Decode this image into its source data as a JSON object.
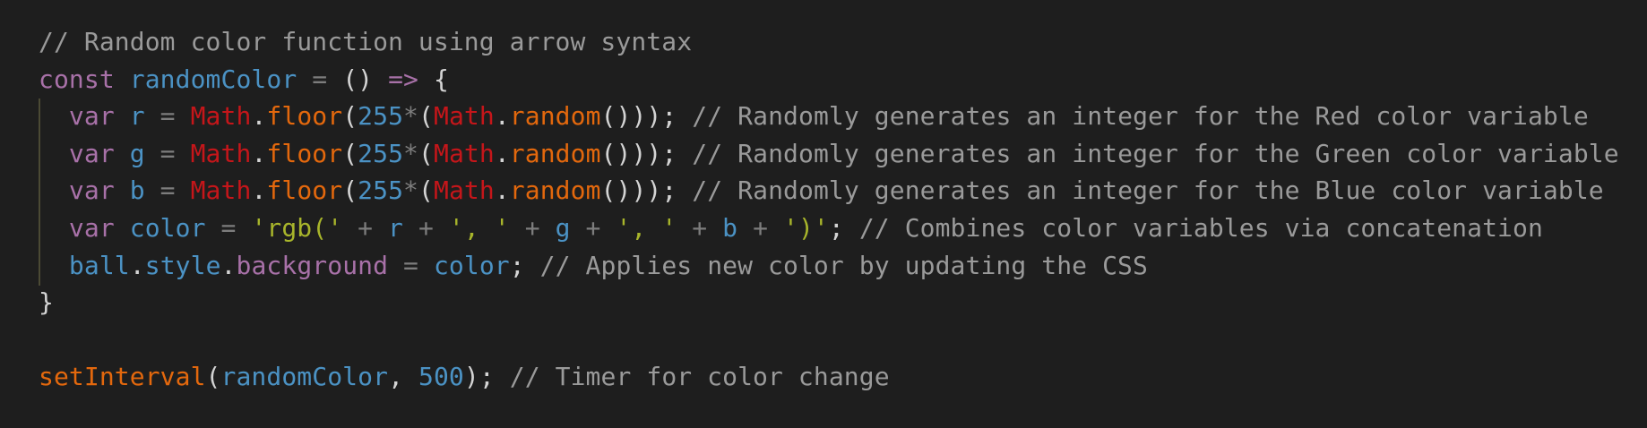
{
  "colors": {
    "background": "#1e1e1e",
    "comment": "#9a9a9a",
    "keyword": "#a871a8",
    "identifier": "#4b92c4",
    "builtin_object": "#c5161a",
    "function": "#e3680d",
    "string": "#a8b52b"
  },
  "code_lines": [
    [
      [
        "cm",
        "// Random color function using arrow syntax"
      ]
    ],
    [
      [
        "kw",
        "const"
      ],
      [
        "pn",
        " "
      ],
      [
        "id",
        "randomColor"
      ],
      [
        "op",
        " = "
      ],
      [
        "pn",
        "() "
      ],
      [
        "kw",
        "=>"
      ],
      [
        "pn",
        " {"
      ]
    ],
    [
      [
        "pn",
        "  "
      ],
      [
        "kw",
        "var"
      ],
      [
        "id",
        " r"
      ],
      [
        "op",
        " = "
      ],
      [
        "obj",
        "Math"
      ],
      [
        "pn",
        "."
      ],
      [
        "fn",
        "floor"
      ],
      [
        "pn",
        "("
      ],
      [
        "num",
        "255"
      ],
      [
        "op",
        "*"
      ],
      [
        "pn",
        "("
      ],
      [
        "obj",
        "Math"
      ],
      [
        "pn",
        "."
      ],
      [
        "fn",
        "random"
      ],
      [
        "pn",
        "()));"
      ],
      [
        "cm",
        " // Randomly generates an integer for the Red color variable"
      ]
    ],
    [
      [
        "pn",
        "  "
      ],
      [
        "kw",
        "var"
      ],
      [
        "id",
        " g"
      ],
      [
        "op",
        " = "
      ],
      [
        "obj",
        "Math"
      ],
      [
        "pn",
        "."
      ],
      [
        "fn",
        "floor"
      ],
      [
        "pn",
        "("
      ],
      [
        "num",
        "255"
      ],
      [
        "op",
        "*"
      ],
      [
        "pn",
        "("
      ],
      [
        "obj",
        "Math"
      ],
      [
        "pn",
        "."
      ],
      [
        "fn",
        "random"
      ],
      [
        "pn",
        "()));"
      ],
      [
        "cm",
        " // Randomly generates an integer for the Green color variable"
      ]
    ],
    [
      [
        "pn",
        "  "
      ],
      [
        "kw",
        "var"
      ],
      [
        "id",
        " b"
      ],
      [
        "op",
        " = "
      ],
      [
        "obj",
        "Math"
      ],
      [
        "pn",
        "."
      ],
      [
        "fn",
        "floor"
      ],
      [
        "pn",
        "("
      ],
      [
        "num",
        "255"
      ],
      [
        "op",
        "*"
      ],
      [
        "pn",
        "("
      ],
      [
        "obj",
        "Math"
      ],
      [
        "pn",
        "."
      ],
      [
        "fn",
        "random"
      ],
      [
        "pn",
        "()));"
      ],
      [
        "cm",
        " // Randomly generates an integer for the Blue color variable"
      ]
    ],
    [
      [
        "pn",
        "  "
      ],
      [
        "kw",
        "var"
      ],
      [
        "id",
        " color"
      ],
      [
        "op",
        " = "
      ],
      [
        "str",
        "'rgb('"
      ],
      [
        "op",
        " + "
      ],
      [
        "id",
        "r"
      ],
      [
        "op",
        " + "
      ],
      [
        "str",
        "', '"
      ],
      [
        "op",
        " + "
      ],
      [
        "id",
        "g"
      ],
      [
        "op",
        " + "
      ],
      [
        "str",
        "', '"
      ],
      [
        "op",
        " + "
      ],
      [
        "id",
        "b"
      ],
      [
        "op",
        " + "
      ],
      [
        "str",
        "')'"
      ],
      [
        "pn",
        ";"
      ],
      [
        "cm",
        " // Combines color variables via concatenation"
      ]
    ],
    [
      [
        "pn",
        "  "
      ],
      [
        "id",
        "ball"
      ],
      [
        "pn",
        "."
      ],
      [
        "id",
        "style"
      ],
      [
        "pn",
        "."
      ],
      [
        "prop",
        "background"
      ],
      [
        "op",
        " = "
      ],
      [
        "id",
        "color"
      ],
      [
        "pn",
        ";"
      ],
      [
        "cm",
        " // Applies new color by updating the CSS"
      ]
    ],
    [
      [
        "pn",
        "}"
      ]
    ],
    [],
    [
      [
        "fn",
        "setInterval"
      ],
      [
        "pn",
        "("
      ],
      [
        "id",
        "randomColor"
      ],
      [
        "pn",
        ", "
      ],
      [
        "num",
        "500"
      ],
      [
        "pn",
        ");"
      ],
      [
        "cm",
        " // Timer for color change"
      ]
    ]
  ]
}
